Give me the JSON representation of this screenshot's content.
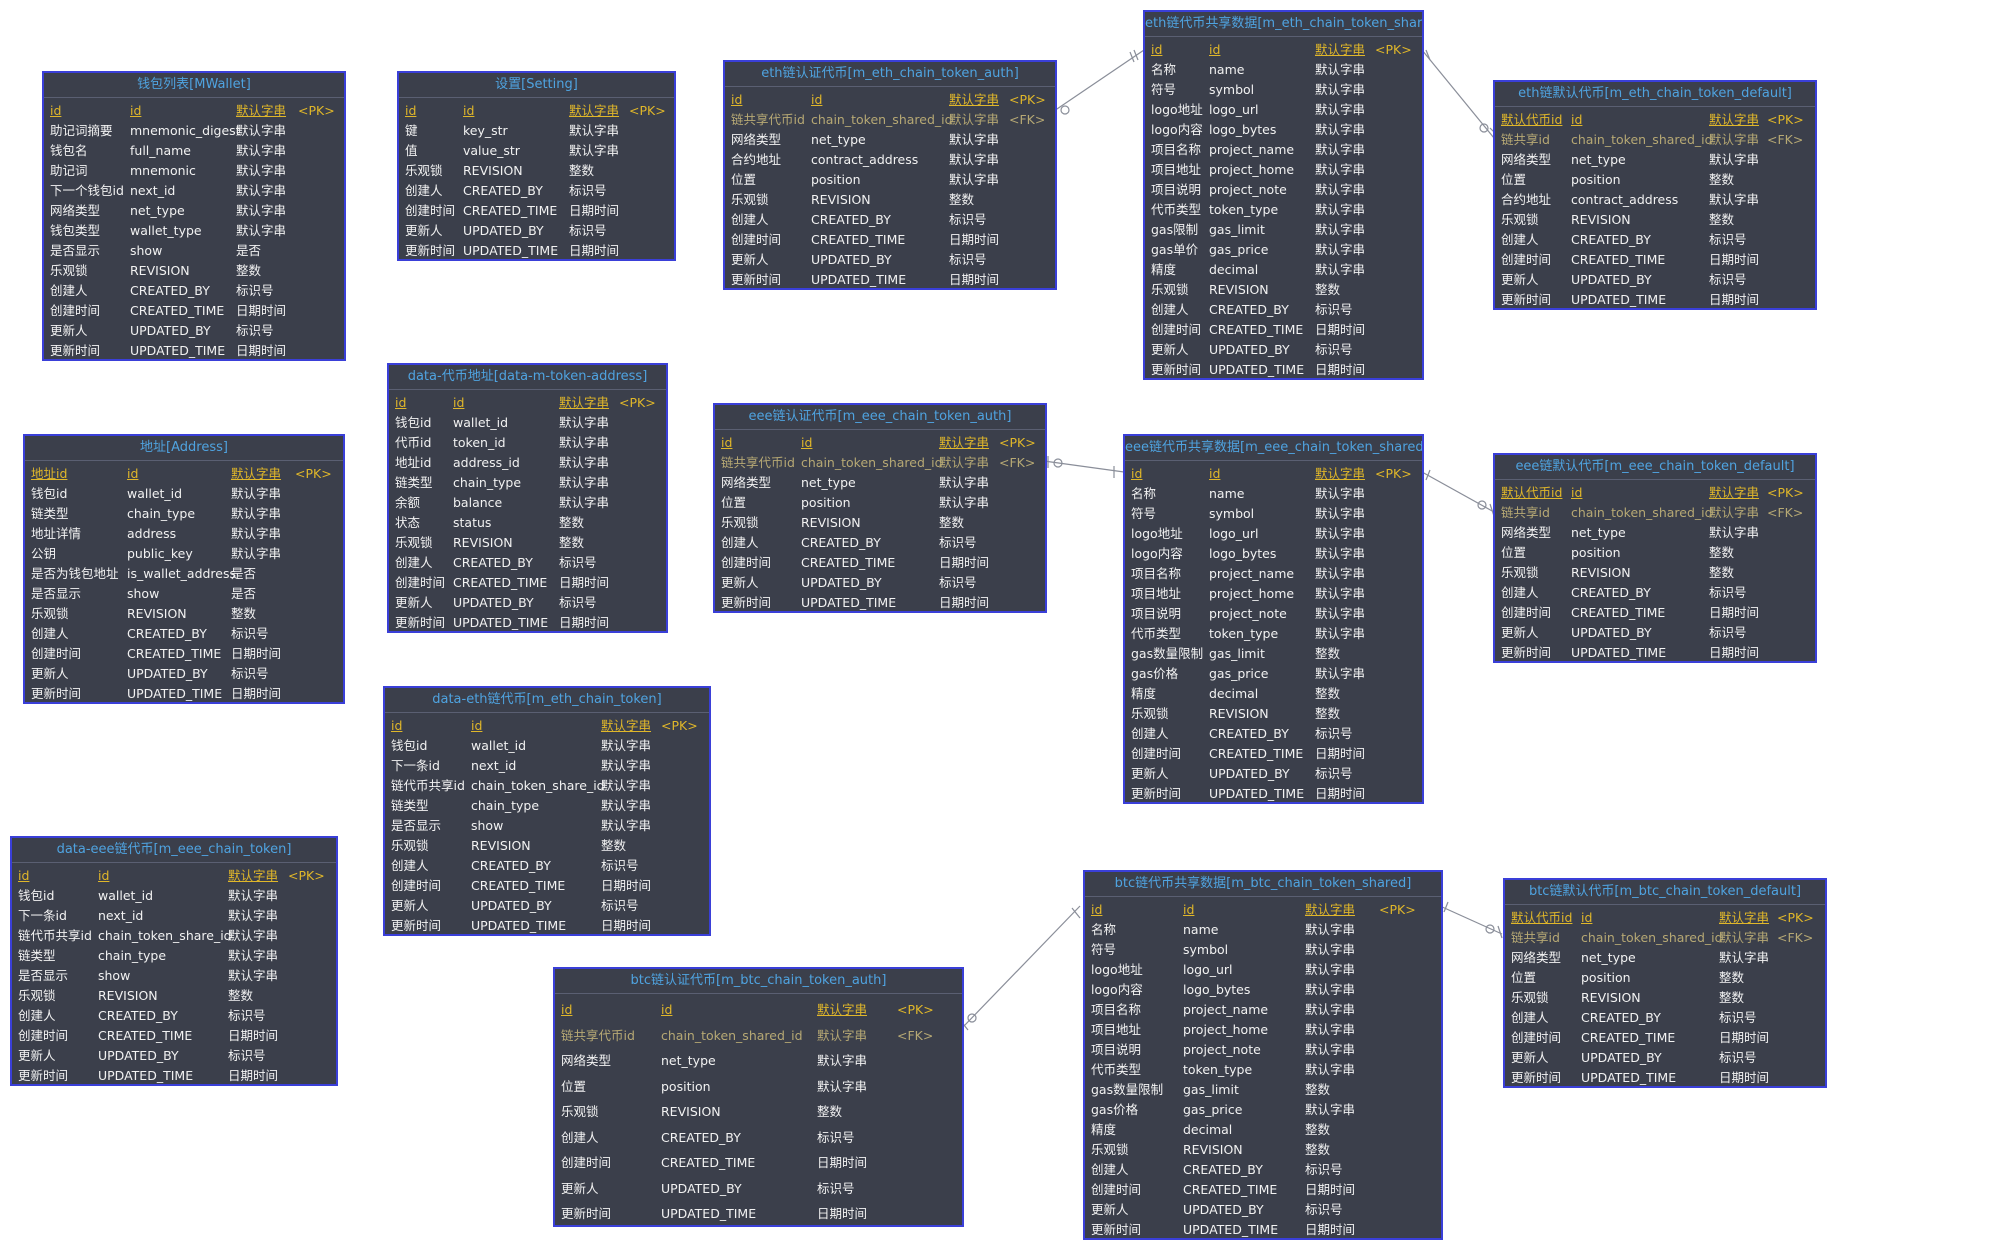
{
  "tables": [
    {
      "title": "钱包列表[MWallet]",
      "rows": [
        [
          "id",
          "id",
          "默认字串",
          "<PK>"
        ],
        [
          "助记词摘要",
          "mnemonic_digest",
          "默认字串",
          ""
        ],
        [
          "钱包名",
          "full_name",
          "默认字串",
          ""
        ],
        [
          "助记词",
          "mnemonic",
          "默认字串",
          ""
        ],
        [
          "下一个钱包id",
          "next_id",
          "默认字串",
          ""
        ],
        [
          "网络类型",
          "net_type",
          "默认字串",
          ""
        ],
        [
          "钱包类型",
          "wallet_type",
          "默认字串",
          ""
        ],
        [
          "是否显示",
          "show",
          "是否",
          ""
        ],
        [
          "乐观锁",
          "REVISION",
          "整数",
          ""
        ],
        [
          "创建人",
          "CREATED_BY",
          "标识号",
          ""
        ],
        [
          "创建时间",
          "CREATED_TIME",
          "日期时间",
          ""
        ],
        [
          "更新人",
          "UPDATED_BY",
          "标识号",
          ""
        ],
        [
          "更新时间",
          "UPDATED_TIME",
          "日期时间",
          ""
        ]
      ]
    },
    {
      "title": "设置[Setting]",
      "rows": [
        [
          "id",
          "id",
          "默认字串",
          "<PK>"
        ],
        [
          "键",
          "key_str",
          "默认字串",
          ""
        ],
        [
          "值",
          "value_str",
          "默认字串",
          ""
        ],
        [
          "乐观锁",
          "REVISION",
          "整数",
          ""
        ],
        [
          "创建人",
          "CREATED_BY",
          "标识号",
          ""
        ],
        [
          "创建时间",
          "CREATED_TIME",
          "日期时间",
          ""
        ],
        [
          "更新人",
          "UPDATED_BY",
          "标识号",
          ""
        ],
        [
          "更新时间",
          "UPDATED_TIME",
          "日期时间",
          ""
        ]
      ]
    },
    {
      "title": "eth链认证代币[m_eth_chain_token_auth]",
      "rows": [
        [
          "id",
          "id",
          "默认字串",
          "<PK>"
        ],
        [
          "链共享代币id",
          "chain_token_shared_id",
          "默认字串",
          "<FK>"
        ],
        [
          "网络类型",
          "net_type",
          "默认字串",
          ""
        ],
        [
          "合约地址",
          "contract_address",
          "默认字串",
          ""
        ],
        [
          "位置",
          "position",
          "默认字串",
          ""
        ],
        [
          "乐观锁",
          "REVISION",
          "整数",
          ""
        ],
        [
          "创建人",
          "CREATED_BY",
          "标识号",
          ""
        ],
        [
          "创建时间",
          "CREATED_TIME",
          "日期时间",
          ""
        ],
        [
          "更新人",
          "UPDATED_BY",
          "标识号",
          ""
        ],
        [
          "更新时间",
          "UPDATED_TIME",
          "日期时间",
          ""
        ]
      ]
    },
    {
      "title": "eth链代币共享数据[m_eth_chain_token_shared]",
      "rows": [
        [
          "id",
          "id",
          "默认字串",
          "<PK>"
        ],
        [
          "名称",
          "name",
          "默认字串",
          ""
        ],
        [
          "符号",
          "symbol",
          "默认字串",
          ""
        ],
        [
          "logo地址",
          "logo_url",
          "默认字串",
          ""
        ],
        [
          "logo内容",
          "logo_bytes",
          "默认字串",
          ""
        ],
        [
          "项目名称",
          "project_name",
          "默认字串",
          ""
        ],
        [
          "项目地址",
          "project_home",
          "默认字串",
          ""
        ],
        [
          "项目说明",
          "project_note",
          "默认字串",
          ""
        ],
        [
          "代币类型",
          "token_type",
          "默认字串",
          ""
        ],
        [
          "gas限制",
          "gas_limit",
          "默认字串",
          ""
        ],
        [
          "gas单价",
          "gas_price",
          "默认字串",
          ""
        ],
        [
          "精度",
          "decimal",
          "默认字串",
          ""
        ],
        [
          "乐观锁",
          "REVISION",
          "整数",
          ""
        ],
        [
          "创建人",
          "CREATED_BY",
          "标识号",
          ""
        ],
        [
          "创建时间",
          "CREATED_TIME",
          "日期时间",
          ""
        ],
        [
          "更新人",
          "UPDATED_BY",
          "标识号",
          ""
        ],
        [
          "更新时间",
          "UPDATED_TIME",
          "日期时间",
          ""
        ]
      ]
    },
    {
      "title": "eth链默认代币[m_eth_chain_token_default]",
      "rows": [
        [
          "默认代币id",
          "id",
          "默认字串",
          "<PK>"
        ],
        [
          "链共享id",
          "chain_token_shared_id",
          "默认字串",
          "<FK>"
        ],
        [
          "网络类型",
          "net_type",
          "默认字串",
          ""
        ],
        [
          "位置",
          "position",
          "整数",
          ""
        ],
        [
          "合约地址",
          "contract_address",
          "默认字串",
          ""
        ],
        [
          "乐观锁",
          "REVISION",
          "整数",
          ""
        ],
        [
          "创建人",
          "CREATED_BY",
          "标识号",
          ""
        ],
        [
          "创建时间",
          "CREATED_TIME",
          "日期时间",
          ""
        ],
        [
          "更新人",
          "UPDATED_BY",
          "标识号",
          ""
        ],
        [
          "更新时间",
          "UPDATED_TIME",
          "日期时间",
          ""
        ]
      ]
    },
    {
      "title": "地址[Address]",
      "rows": [
        [
          "地址id",
          "id",
          "默认字串",
          "<PK>"
        ],
        [
          "钱包id",
          "wallet_id",
          "默认字串",
          ""
        ],
        [
          "链类型",
          "chain_type",
          "默认字串",
          ""
        ],
        [
          "地址详情",
          "address",
          "默认字串",
          ""
        ],
        [
          "公钥",
          "public_key",
          "默认字串",
          ""
        ],
        [
          "是否为钱包地址",
          "is_wallet_address",
          "是否",
          ""
        ],
        [
          "是否显示",
          "show",
          "是否",
          ""
        ],
        [
          "乐观锁",
          "REVISION",
          "整数",
          ""
        ],
        [
          "创建人",
          "CREATED_BY",
          "标识号",
          ""
        ],
        [
          "创建时间",
          "CREATED_TIME",
          "日期时间",
          ""
        ],
        [
          "更新人",
          "UPDATED_BY",
          "标识号",
          ""
        ],
        [
          "更新时间",
          "UPDATED_TIME",
          "日期时间",
          ""
        ]
      ]
    },
    {
      "title": "data-代币地址[data-m-token-address]",
      "rows": [
        [
          "id",
          "id",
          "默认字串",
          "<PK>"
        ],
        [
          "钱包id",
          "wallet_id",
          "默认字串",
          ""
        ],
        [
          "代币id",
          "token_id",
          "默认字串",
          ""
        ],
        [
          "地址id",
          "address_id",
          "默认字串",
          ""
        ],
        [
          "链类型",
          "chain_type",
          "默认字串",
          ""
        ],
        [
          "余额",
          "balance",
          "默认字串",
          ""
        ],
        [
          "状态",
          "status",
          "整数",
          ""
        ],
        [
          "乐观锁",
          "REVISION",
          "整数",
          ""
        ],
        [
          "创建人",
          "CREATED_BY",
          "标识号",
          ""
        ],
        [
          "创建时间",
          "CREATED_TIME",
          "日期时间",
          ""
        ],
        [
          "更新人",
          "UPDATED_BY",
          "标识号",
          ""
        ],
        [
          "更新时间",
          "UPDATED_TIME",
          "日期时间",
          ""
        ]
      ]
    },
    {
      "title": "eee链认证代币[m_eee_chain_token_auth]",
      "rows": [
        [
          "id",
          "id",
          "默认字串",
          "<PK>"
        ],
        [
          "链共享代币id",
          "chain_token_shared_id",
          "默认字串",
          "<FK>"
        ],
        [
          "网络类型",
          "net_type",
          "默认字串",
          ""
        ],
        [
          "位置",
          "position",
          "默认字串",
          ""
        ],
        [
          "乐观锁",
          "REVISION",
          "整数",
          ""
        ],
        [
          "创建人",
          "CREATED_BY",
          "标识号",
          ""
        ],
        [
          "创建时间",
          "CREATED_TIME",
          "日期时间",
          ""
        ],
        [
          "更新人",
          "UPDATED_BY",
          "标识号",
          ""
        ],
        [
          "更新时间",
          "UPDATED_TIME",
          "日期时间",
          ""
        ]
      ]
    },
    {
      "title": "eee链代币共享数据[m_eee_chain_token_shared]",
      "rows": [
        [
          "id",
          "id",
          "默认字串",
          "<PK>"
        ],
        [
          "名称",
          "name",
          "默认字串",
          ""
        ],
        [
          "符号",
          "symbol",
          "默认字串",
          ""
        ],
        [
          "logo地址",
          "logo_url",
          "默认字串",
          ""
        ],
        [
          "logo内容",
          "logo_bytes",
          "默认字串",
          ""
        ],
        [
          "项目名称",
          "project_name",
          "默认字串",
          ""
        ],
        [
          "项目地址",
          "project_home",
          "默认字串",
          ""
        ],
        [
          "项目说明",
          "project_note",
          "默认字串",
          ""
        ],
        [
          "代币类型",
          "token_type",
          "默认字串",
          ""
        ],
        [
          "gas数量限制",
          "gas_limit",
          "整数",
          ""
        ],
        [
          "gas价格",
          "gas_price",
          "默认字串",
          ""
        ],
        [
          "精度",
          "decimal",
          "整数",
          ""
        ],
        [
          "乐观锁",
          "REVISION",
          "整数",
          ""
        ],
        [
          "创建人",
          "CREATED_BY",
          "标识号",
          ""
        ],
        [
          "创建时间",
          "CREATED_TIME",
          "日期时间",
          ""
        ],
        [
          "更新人",
          "UPDATED_BY",
          "标识号",
          ""
        ],
        [
          "更新时间",
          "UPDATED_TIME",
          "日期时间",
          ""
        ]
      ]
    },
    {
      "title": "eee链默认代币[m_eee_chain_token_default]",
      "rows": [
        [
          "默认代币id",
          "id",
          "默认字串",
          "<PK>"
        ],
        [
          "链共享id",
          "chain_token_shared_id",
          "默认字串",
          "<FK>"
        ],
        [
          "网络类型",
          "net_type",
          "默认字串",
          ""
        ],
        [
          "位置",
          "position",
          "整数",
          ""
        ],
        [
          "乐观锁",
          "REVISION",
          "整数",
          ""
        ],
        [
          "创建人",
          "CREATED_BY",
          "标识号",
          ""
        ],
        [
          "创建时间",
          "CREATED_TIME",
          "日期时间",
          ""
        ],
        [
          "更新人",
          "UPDATED_BY",
          "标识号",
          ""
        ],
        [
          "更新时间",
          "UPDATED_TIME",
          "日期时间",
          ""
        ]
      ]
    },
    {
      "title": "data-eth链代币[m_eth_chain_token]",
      "rows": [
        [
          "id",
          "id",
          "默认字串",
          "<PK>"
        ],
        [
          "钱包id",
          "wallet_id",
          "默认字串",
          ""
        ],
        [
          "下一条id",
          "next_id",
          "默认字串",
          ""
        ],
        [
          "链代币共享id",
          "chain_token_share_id",
          "默认字串",
          ""
        ],
        [
          "链类型",
          "chain_type",
          "默认字串",
          ""
        ],
        [
          "是否显示",
          "show",
          "默认字串",
          ""
        ],
        [
          "乐观锁",
          "REVISION",
          "整数",
          ""
        ],
        [
          "创建人",
          "CREATED_BY",
          "标识号",
          ""
        ],
        [
          "创建时间",
          "CREATED_TIME",
          "日期时间",
          ""
        ],
        [
          "更新人",
          "UPDATED_BY",
          "标识号",
          ""
        ],
        [
          "更新时间",
          "UPDATED_TIME",
          "日期时间",
          ""
        ]
      ]
    },
    {
      "title": "data-eee链代币[m_eee_chain_token]",
      "rows": [
        [
          "id",
          "id",
          "默认字串",
          "<PK>"
        ],
        [
          "钱包id",
          "wallet_id",
          "默认字串",
          ""
        ],
        [
          "下一条id",
          "next_id",
          "默认字串",
          ""
        ],
        [
          "链代币共享id",
          "chain_token_share_id",
          "默认字串",
          ""
        ],
        [
          "链类型",
          "chain_type",
          "默认字串",
          ""
        ],
        [
          "是否显示",
          "show",
          "默认字串",
          ""
        ],
        [
          "乐观锁",
          "REVISION",
          "整数",
          ""
        ],
        [
          "创建人",
          "CREATED_BY",
          "标识号",
          ""
        ],
        [
          "创建时间",
          "CREATED_TIME",
          "日期时间",
          ""
        ],
        [
          "更新人",
          "UPDATED_BY",
          "标识号",
          ""
        ],
        [
          "更新时间",
          "UPDATED_TIME",
          "日期时间",
          ""
        ]
      ]
    },
    {
      "title": "btc链认证代币[m_btc_chain_token_auth]",
      "rows": [
        [
          "id",
          "id",
          "默认字串",
          "<PK>"
        ],
        [
          "链共享代币id",
          "chain_token_shared_id",
          "默认字串",
          "<FK>"
        ],
        [
          "网络类型",
          "net_type",
          "默认字串",
          ""
        ],
        [
          "位置",
          "position",
          "默认字串",
          ""
        ],
        [
          "乐观锁",
          "REVISION",
          "整数",
          ""
        ],
        [
          "创建人",
          "CREATED_BY",
          "标识号",
          ""
        ],
        [
          "创建时间",
          "CREATED_TIME",
          "日期时间",
          ""
        ],
        [
          "更新人",
          "UPDATED_BY",
          "标识号",
          ""
        ],
        [
          "更新时间",
          "UPDATED_TIME",
          "日期时间",
          ""
        ]
      ]
    },
    {
      "title": "btc链代币共享数据[m_btc_chain_token_shared]",
      "rows": [
        [
          "id",
          "id",
          "默认字串",
          "<PK>"
        ],
        [
          "名称",
          "name",
          "默认字串",
          ""
        ],
        [
          "符号",
          "symbol",
          "默认字串",
          ""
        ],
        [
          "logo地址",
          "logo_url",
          "默认字串",
          ""
        ],
        [
          "logo内容",
          "logo_bytes",
          "默认字串",
          ""
        ],
        [
          "项目名称",
          "project_name",
          "默认字串",
          ""
        ],
        [
          "项目地址",
          "project_home",
          "默认字串",
          ""
        ],
        [
          "项目说明",
          "project_note",
          "默认字串",
          ""
        ],
        [
          "代币类型",
          "token_type",
          "默认字串",
          ""
        ],
        [
          "gas数量限制",
          "gas_limit",
          "整数",
          ""
        ],
        [
          "gas价格",
          "gas_price",
          "默认字串",
          ""
        ],
        [
          "精度",
          "decimal",
          "整数",
          ""
        ],
        [
          "乐观锁",
          "REVISION",
          "整数",
          ""
        ],
        [
          "创建人",
          "CREATED_BY",
          "标识号",
          ""
        ],
        [
          "创建时间",
          "CREATED_TIME",
          "日期时间",
          ""
        ],
        [
          "更新人",
          "UPDATED_BY",
          "标识号",
          ""
        ],
        [
          "更新时间",
          "UPDATED_TIME",
          "日期时间",
          ""
        ]
      ]
    },
    {
      "title": "btc链默认代币[m_btc_chain_token_default]",
      "rows": [
        [
          "默认代币id",
          "id",
          "默认字串",
          "<PK>"
        ],
        [
          "链共享id",
          "chain_token_shared_id",
          "默认字串",
          "<FK>"
        ],
        [
          "网络类型",
          "net_type",
          "默认字串",
          ""
        ],
        [
          "位置",
          "position",
          "整数",
          ""
        ],
        [
          "乐观锁",
          "REVISION",
          "整数",
          ""
        ],
        [
          "创建人",
          "CREATED_BY",
          "标识号",
          ""
        ],
        [
          "创建时间",
          "CREATED_TIME",
          "日期时间",
          ""
        ],
        [
          "更新人",
          "UPDATED_BY",
          "标识号",
          ""
        ],
        [
          "更新时间",
          "UPDATED_TIME",
          "日期时间",
          ""
        ]
      ]
    }
  ]
}
